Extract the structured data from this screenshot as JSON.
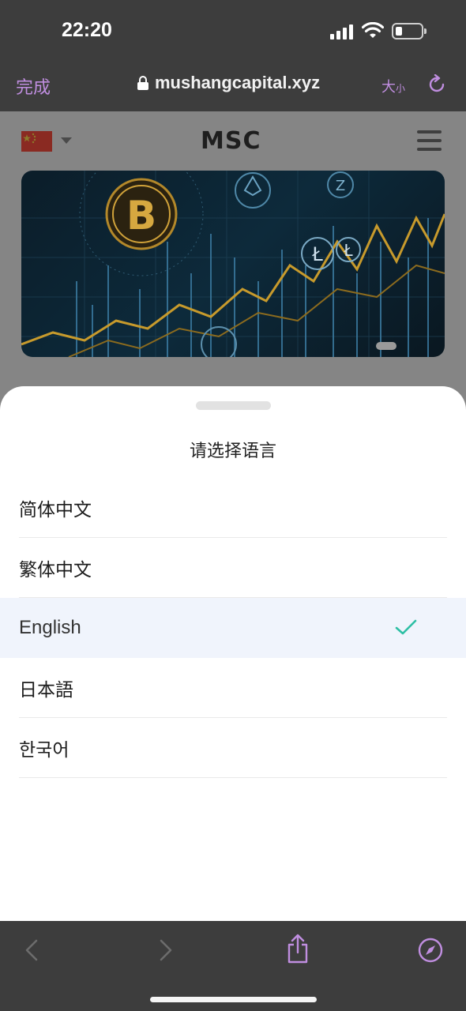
{
  "status_bar": {
    "time": "22:20",
    "signal_icon": "cellular-signal-icon",
    "wifi_icon": "wifi-icon",
    "battery_icon": "battery-low-icon",
    "battery_level": 0.2
  },
  "browser": {
    "done_label": "完成",
    "url": "mushangcapital.xyz",
    "lock_icon": "lock-icon",
    "text_size_big": "大",
    "text_size_small": "小",
    "reload_icon": "reload-icon",
    "accent_color": "#c08ee0"
  },
  "site": {
    "flag_icon": "china-flag-icon",
    "logo": "MSC",
    "menu_icon": "hamburger-menu-icon",
    "banner_icon": "bitcoin-chart-banner-image"
  },
  "language_sheet": {
    "title": "请选择语言",
    "languages": [
      {
        "label": "简体中文",
        "selected": false
      },
      {
        "label": "繁体中文",
        "selected": false
      },
      {
        "label": "English",
        "selected": true
      },
      {
        "label": "日本語",
        "selected": false
      },
      {
        "label": "한국어",
        "selected": false
      }
    ],
    "check_color": "#2dbfa4",
    "selected_bg": "#f0f4fc"
  },
  "toolbar": {
    "back_icon": "chevron-left-icon",
    "forward_icon": "chevron-right-icon",
    "share_icon": "share-icon",
    "safari_icon": "compass-icon"
  }
}
